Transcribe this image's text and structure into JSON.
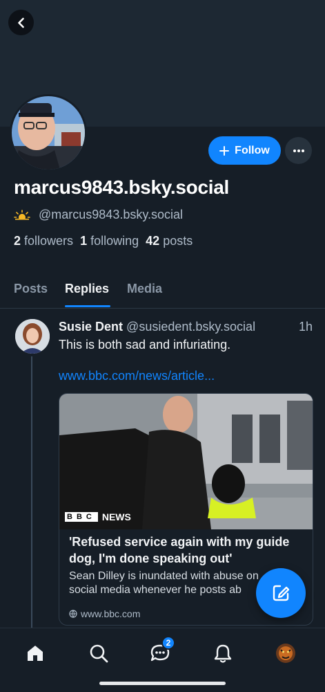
{
  "profile": {
    "display_name": "marcus9843.bsky.social",
    "handle": "@marcus9843.bsky.social",
    "badge_emoji": "sun-behind-cloud",
    "followers_count": "2",
    "followers_label": "followers",
    "following_count": "1",
    "following_label": "following",
    "posts_count": "42",
    "posts_label": "posts"
  },
  "actions": {
    "follow_label": "Follow",
    "more_icon": "ellipsis-icon",
    "back_icon": "chevron-left-icon"
  },
  "tabs": [
    {
      "label": "Posts",
      "active": false
    },
    {
      "label": "Replies",
      "active": true
    },
    {
      "label": "Media",
      "active": false
    }
  ],
  "post": {
    "author_name": "Susie Dent",
    "author_handle": "@susiedent.bsky.social",
    "time": "1h",
    "text": "This is both sad and infuriating.",
    "link": "www.bbc.com/news/article...",
    "card": {
      "image_caption_brand": "BBC",
      "image_caption_label": "NEWS",
      "title": "'Refused service again with my guide dog, I'm done speaking out'",
      "description": "Sean Dilley is inundated with abuse on social media whenever he posts ab",
      "domain": "www.bbc.com"
    }
  },
  "nav": {
    "items": [
      "home-icon",
      "search-icon",
      "chat-icon",
      "bell-icon",
      "profile-avatar"
    ],
    "chat_badge": "2"
  },
  "colors": {
    "accent": "#1185fe",
    "background": "#161e27",
    "banner": "#1d2833"
  }
}
